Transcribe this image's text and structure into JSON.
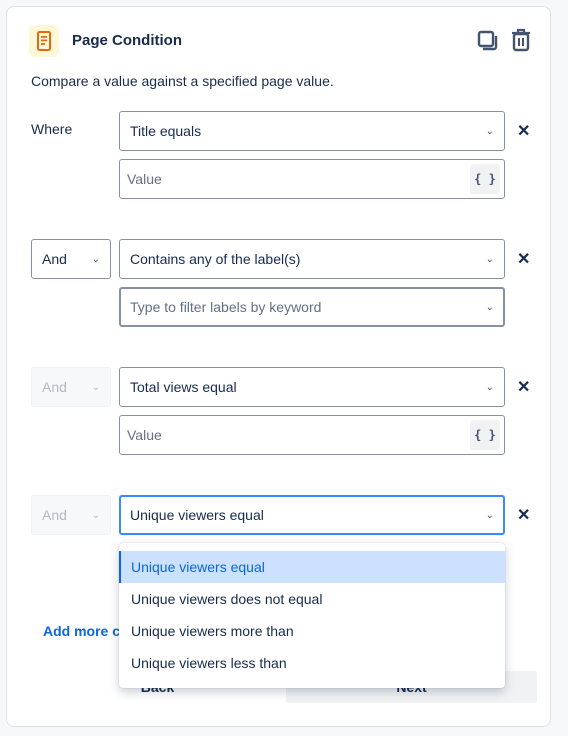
{
  "header": {
    "title": "Page Condition",
    "icon": "page-document-icon",
    "accent": "#e56910",
    "actions": [
      "copy-icon",
      "trash-icon"
    ]
  },
  "description": "Compare a value against a specified page value.",
  "conditions": [
    {
      "connector": "Where",
      "field": "Title equals",
      "value_placeholder": "Value"
    },
    {
      "connector": "And",
      "field": "Contains any of the label(s)",
      "filter_placeholder": "Type to filter labels by keyword"
    },
    {
      "connector": "And",
      "field": "Total views equal",
      "value_placeholder": "Value"
    },
    {
      "connector": "And",
      "field": "Unique viewers equal"
    }
  ],
  "brace_label": "{ }",
  "dropdown": {
    "options": [
      "Unique viewers equal",
      "Unique viewers does not equal",
      "Unique viewers more than",
      "Unique viewers less than"
    ],
    "selected": "Unique viewers equal"
  },
  "add_more": "Add more conditions",
  "footer": {
    "back": "Back",
    "next": "Next"
  },
  "colors": {
    "focus": "#388bff",
    "selected_bg": "#cce0ff",
    "link": "#0c66e4"
  }
}
